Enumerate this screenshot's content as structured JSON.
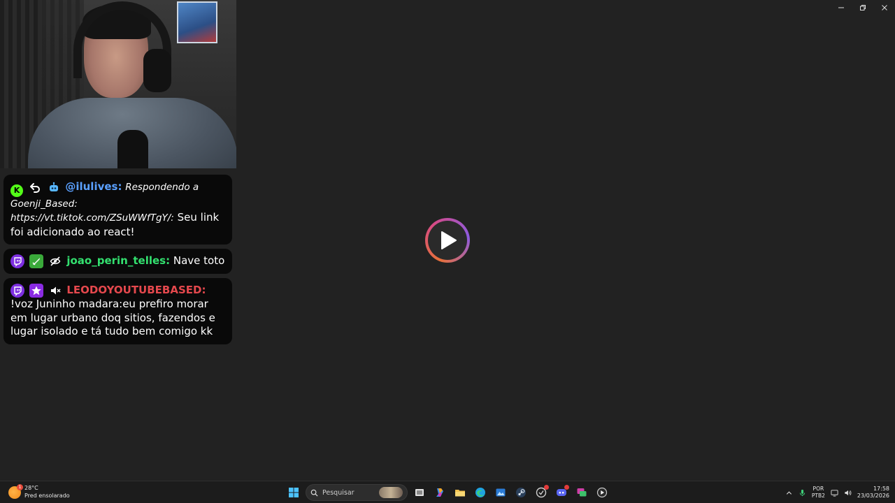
{
  "window": {
    "minimize": "—",
    "restore": "❐",
    "close": "✕"
  },
  "chat": [
    {
      "username": "@ilulives:",
      "reply_prefix": "Respondendo a",
      "reply_target": "Goenji_Based:",
      "reply_link": "https://vt.tiktok.com/ZSuWWfTgY/:",
      "text": "Seu link foi adicionado ao react!",
      "badges": [
        "kick-icon",
        "reply-icon",
        "bot-icon"
      ],
      "color": "#5aa0ff"
    },
    {
      "username": "joao_perin_telles:",
      "text": "Nave toto",
      "badges": [
        "twitch-icon",
        "sword-icon",
        "eye-off-icon"
      ],
      "color": "#33e06f"
    },
    {
      "username": "LEODOYOUTUBEBASED:",
      "text": "!voz Juninho madara:eu prefiro morar em lugar urbano doq sitios, fazendos e lugar isolado e tá tudo bem comigo kk",
      "badges": [
        "twitch-icon",
        "star-icon",
        "mute-icon"
      ],
      "color": "#e5484d"
    }
  ],
  "player": {
    "icon": "play-icon"
  },
  "taskbar": {
    "weather_temp": "28°C",
    "weather_desc": "Pred ensolarado",
    "weather_badge": "1",
    "search_placeholder": "Pesquisar",
    "lang_line1": "POR",
    "lang_line2": "PTB2",
    "time": "17:58",
    "date": "23/03/2026",
    "apps": [
      "start-icon",
      "search-icon",
      "task-view-icon",
      "copilot-icon",
      "file-explorer-icon",
      "edge-icon",
      "photos-icon",
      "steam-icon",
      "app-icon",
      "discord-icon",
      "chat-app-icon",
      "media-icon"
    ]
  }
}
